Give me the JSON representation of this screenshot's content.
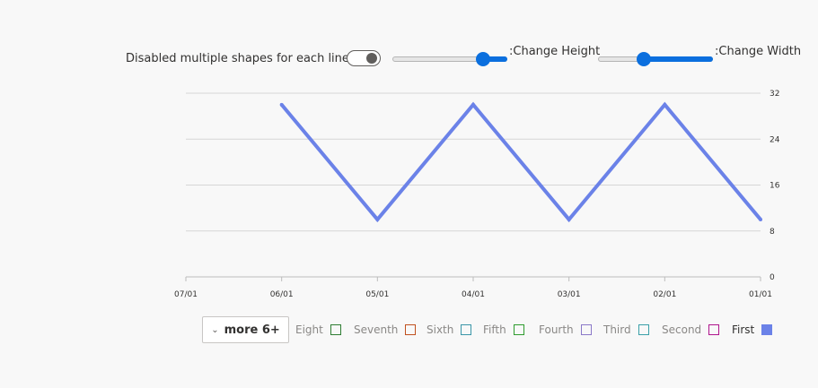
{
  "controls": {
    "shapes_toggle_label": "Disabled multiple shapes for each line",
    "height_slider_label": ":Change Height",
    "width_slider_label": ":Change Width",
    "height_slider_value": 0.83,
    "width_slider_value": 0.38
  },
  "legend": {
    "more_button_label": "more 6+",
    "items": [
      {
        "label": "Eight",
        "color": "#2e7d32",
        "filled": false
      },
      {
        "label": "Seventh",
        "color": "#c0501e",
        "filled": false
      },
      {
        "label": "Sixth",
        "color": "#3a96a8",
        "filled": false
      },
      {
        "label": "Fifth",
        "color": "#2e9b2e",
        "filled": false
      },
      {
        "label": "Fourth",
        "color": "#8a78c8",
        "filled": false
      },
      {
        "label": "Third",
        "color": "#3aa0a8",
        "filled": false
      },
      {
        "label": "Second",
        "color": "#b0158c",
        "filled": false
      },
      {
        "label": "First",
        "color": "#6b82e8",
        "filled": true
      }
    ]
  },
  "chart_data": {
    "type": "line",
    "x_tick_labels": [
      "07/01",
      "06/01",
      "05/01",
      "04/01",
      "03/01",
      "02/01",
      "01/01"
    ],
    "y_ticks": [
      0,
      8,
      16,
      24,
      32
    ],
    "ylim": [
      0,
      32
    ],
    "y_axis_side": "right",
    "grid": true,
    "series": [
      {
        "name": "First",
        "color": "#6b82e8",
        "x": [
          "06/01",
          "05/01",
          "04/01",
          "03/01",
          "02/01",
          "01/01"
        ],
        "values": [
          30,
          10,
          30,
          10,
          30,
          10
        ]
      }
    ]
  }
}
